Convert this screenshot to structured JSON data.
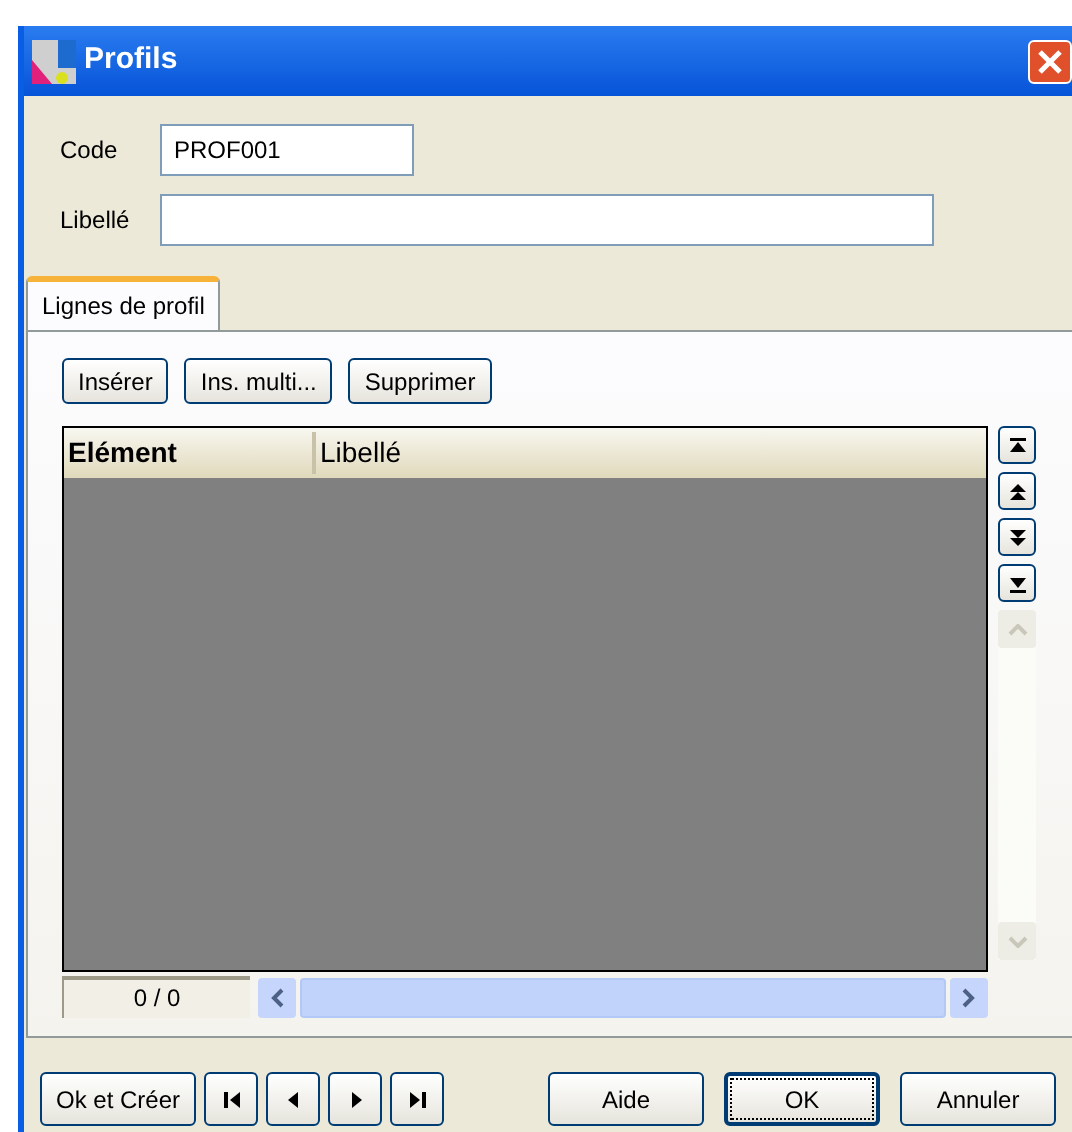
{
  "window": {
    "title": "Profils"
  },
  "fields": [
    {
      "label": "Code",
      "value": "PROF001"
    },
    {
      "label": "Libellé"
    }
  ],
  "tabs": [
    {
      "label": "Lignes de profil",
      "selected": true
    }
  ],
  "toolbar": [
    "Insérer",
    "Ins. multi...",
    "Supprimer"
  ],
  "table": {
    "columns": [
      "Elément",
      "Libellé"
    ]
  },
  "counter": "0 / 0",
  "footer": {
    "left": "Ok et Créer",
    "right": [
      {
        "label": "Aide",
        "default": false
      },
      {
        "label": "OK",
        "default": true
      },
      {
        "label": "Annuler",
        "default": false
      }
    ]
  }
}
